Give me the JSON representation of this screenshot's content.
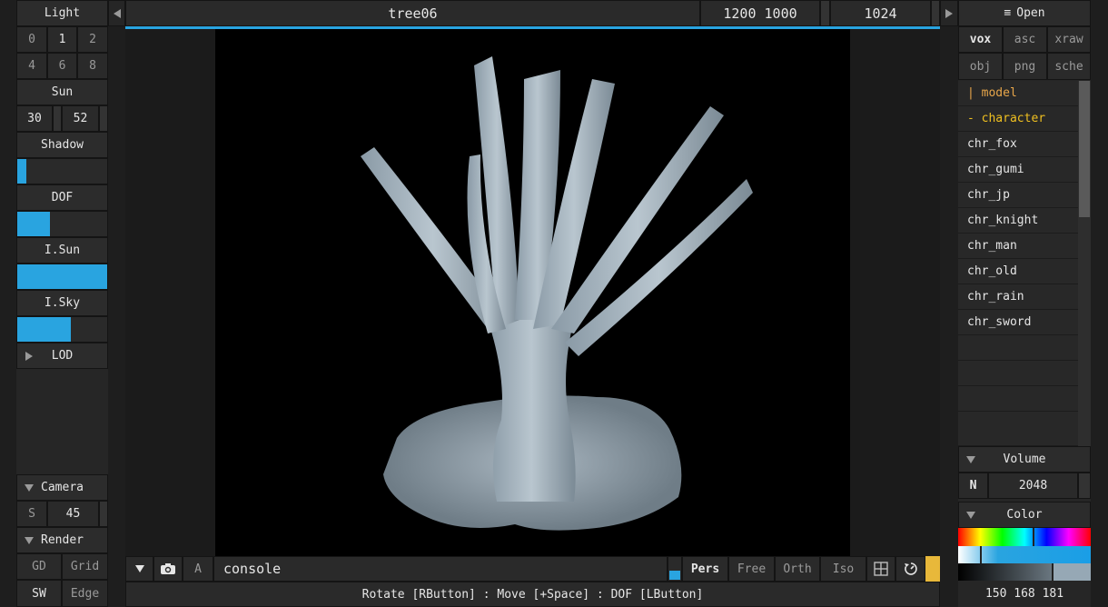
{
  "left_panel": {
    "light_label": "Light",
    "light_options": [
      "0",
      "1",
      "2",
      "4",
      "6",
      "8"
    ],
    "sun_label": "Sun",
    "sun_values": [
      "30",
      "52"
    ],
    "shadow_label": "Shadow",
    "dof_label": "DOF",
    "isun_label": "I.Sun",
    "isky_label": "I.Sky",
    "lod_label": "LOD",
    "camera_label": "Camera",
    "camera_s": "S",
    "camera_value": "45",
    "render_label": "Render",
    "render_options": [
      "GD",
      "Grid",
      "SW",
      "Edge"
    ],
    "sliders": {
      "shadow": 0.1,
      "dof": 0.36,
      "isun": 1.0,
      "isky": 0.6
    }
  },
  "top_bar": {
    "filename": "tree06",
    "resolution": "1200 1000",
    "size": "1024"
  },
  "bottom_bar": {
    "console_label": "console",
    "a_label": "A",
    "view_modes": [
      "Pers",
      "Free",
      "Orth",
      "Iso"
    ],
    "status": "Rotate [RButton] : Move [+Space] : DOF [LButton]"
  },
  "right_panel": {
    "open_label": "Open",
    "formats": [
      "vox",
      "asc",
      "xraw",
      "obj",
      "png",
      "sche"
    ],
    "list": [
      {
        "label": "| model",
        "color": "#e8a64a"
      },
      {
        "label": "- character",
        "color": "#f0c020"
      },
      {
        "label": "chr_fox"
      },
      {
        "label": "chr_gumi"
      },
      {
        "label": "chr_jp"
      },
      {
        "label": "chr_knight"
      },
      {
        "label": "chr_man"
      },
      {
        "label": "chr_old"
      },
      {
        "label": "chr_rain"
      },
      {
        "label": "chr_sword"
      }
    ],
    "volume_label": "Volume",
    "volume_n": "N",
    "volume_value": "2048",
    "color_label": "Color",
    "color_rgb": "150 168 181"
  },
  "colors": {
    "accent": "#29a4e0",
    "yellow": "#e8b83a",
    "model_color": "#e8a64a",
    "character_color": "#f0c020"
  }
}
